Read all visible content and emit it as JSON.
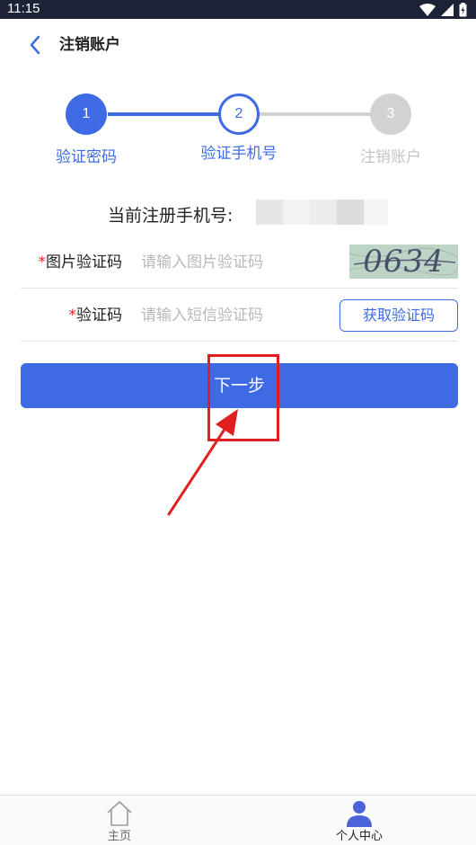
{
  "status_bar": {
    "time": "11:15"
  },
  "header": {
    "title": "注销账户"
  },
  "stepper": {
    "steps": [
      {
        "number": "1",
        "label": "验证密码",
        "state": "done"
      },
      {
        "number": "2",
        "label": "验证手机号",
        "state": "current"
      },
      {
        "number": "3",
        "label": "注销账户",
        "state": "pending"
      }
    ]
  },
  "form": {
    "phone_label": "当前注册手机号:",
    "image_captcha": {
      "required_mark": "*",
      "label": "图片验证码",
      "placeholder": "请输入图片验证码",
      "value": "",
      "captcha_text": "0634"
    },
    "sms_code": {
      "required_mark": "*",
      "label": "验证码",
      "placeholder": "请输入短信验证码",
      "value": "",
      "button_label": "获取验证码"
    },
    "next_button": "下一步"
  },
  "bottom_nav": {
    "items": [
      {
        "label": "主页",
        "icon": "home-icon",
        "active": false
      },
      {
        "label": "个人中心",
        "icon": "person-icon",
        "active": true
      }
    ]
  },
  "colors": {
    "accent": "#3e6be3",
    "required": "#e02020",
    "annotation": "#e02020",
    "status_bar": "#1d2336"
  }
}
